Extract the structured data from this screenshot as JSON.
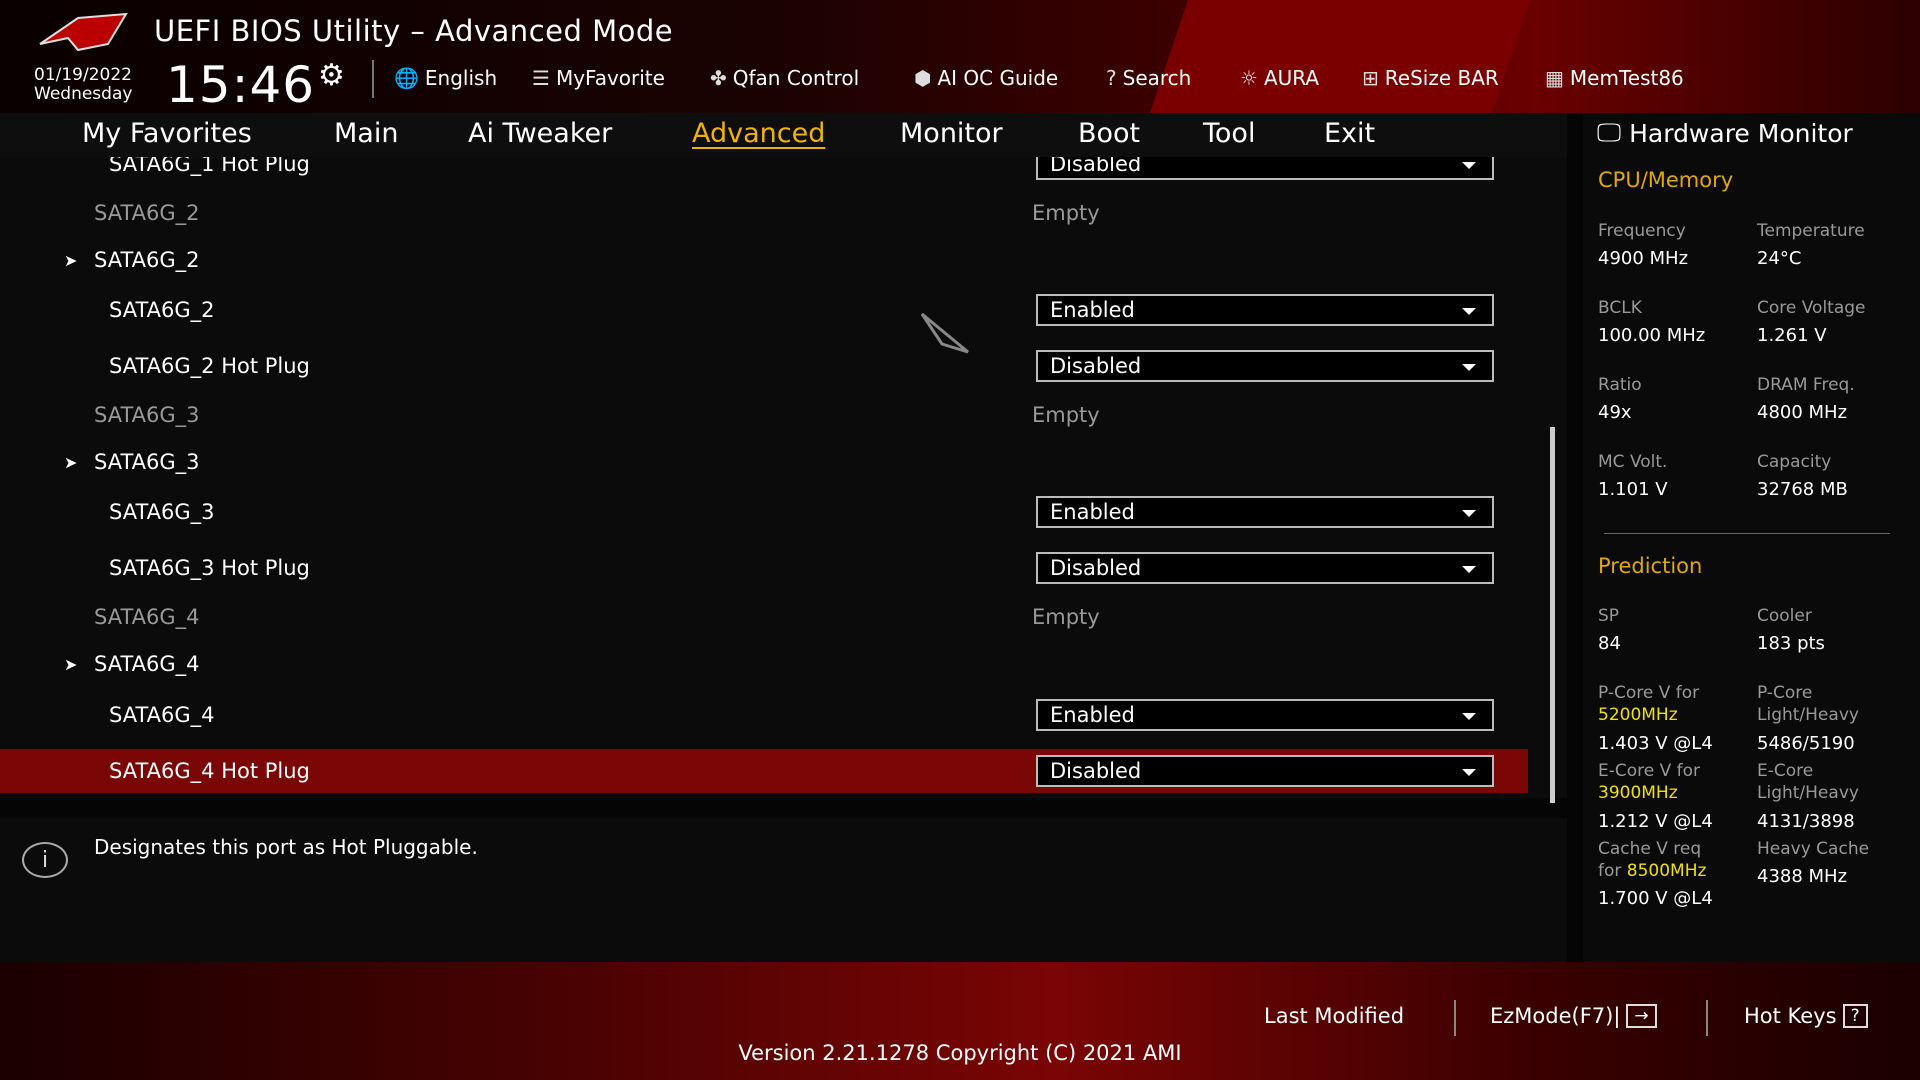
{
  "header": {
    "title": "UEFI BIOS Utility – Advanced Mode",
    "date": "01/19/2022",
    "day": "Wednesday",
    "time": "15:46"
  },
  "toolbar": [
    {
      "icon": "globe-icon",
      "label": "English"
    },
    {
      "icon": "list-icon",
      "label": "MyFavorite"
    },
    {
      "icon": "fan-icon",
      "label": "Qfan Control"
    },
    {
      "icon": "chip-icon",
      "label": "AI OC Guide"
    },
    {
      "icon": "help-box-icon",
      "label": "Search"
    },
    {
      "icon": "aura-icon",
      "label": "AURA"
    },
    {
      "icon": "resize-bar-icon",
      "label": "ReSize BAR"
    },
    {
      "icon": "memory-icon",
      "label": "MemTest86"
    }
  ],
  "nav": [
    "My Favorites",
    "Main",
    "Ai Tweaker",
    "Advanced",
    "Monitor",
    "Boot",
    "Tool",
    "Exit"
  ],
  "nav_active": "Advanced",
  "rows": [
    {
      "type": "dd",
      "label": "SATA6G_1 Hot Plug",
      "value": "Disabled"
    },
    {
      "type": "info",
      "label": "SATA6G_2",
      "value": "Empty"
    },
    {
      "type": "group",
      "label": "SATA6G_2"
    },
    {
      "type": "dd",
      "label": "SATA6G_2",
      "value": "Enabled"
    },
    {
      "type": "dd",
      "label": "SATA6G_2 Hot Plug",
      "value": "Disabled"
    },
    {
      "type": "info",
      "label": "SATA6G_3",
      "value": "Empty"
    },
    {
      "type": "group",
      "label": "SATA6G_3"
    },
    {
      "type": "dd",
      "label": "SATA6G_3",
      "value": "Enabled"
    },
    {
      "type": "dd",
      "label": "SATA6G_3 Hot Plug",
      "value": "Disabled"
    },
    {
      "type": "info",
      "label": "SATA6G_4",
      "value": "Empty"
    },
    {
      "type": "group",
      "label": "SATA6G_4"
    },
    {
      "type": "dd",
      "label": "SATA6G_4",
      "value": "Enabled"
    },
    {
      "type": "dd",
      "label": "SATA6G_4 Hot Plug",
      "value": "Disabled",
      "selected": true
    }
  ],
  "help": "Designates this port as Hot Pluggable.",
  "hw": {
    "title": "Hardware Monitor",
    "cpu_title": "CPU/Memory",
    "cpu": [
      [
        "Frequency",
        "4900 MHz"
      ],
      [
        "Temperature",
        "24°C"
      ],
      [
        "BCLK",
        "100.00 MHz"
      ],
      [
        "Core Voltage",
        "1.261 V"
      ],
      [
        "Ratio",
        "49x"
      ],
      [
        "DRAM Freq.",
        "4800 MHz"
      ],
      [
        "MC Volt.",
        "1.101 V"
      ],
      [
        "Capacity",
        "32768 MB"
      ]
    ],
    "pred_title": "Prediction",
    "sp_label": "SP",
    "sp": "84",
    "cooler_label": "Cooler",
    "cooler": "183 pts",
    "pcore_label": "P-Core V for",
    "pcore_freq": "5200MHz",
    "pcore_v": "1.403 V @L4",
    "pcore_lh_label1": "P-Core",
    "pcore_lh_label2": "Light/Heavy",
    "pcore_lh": "5486/5190",
    "ecore_label": "E-Core V for",
    "ecore_freq": "3900MHz",
    "ecore_v": "1.212 V @L4",
    "ecore_lh_label1": "E-Core",
    "ecore_lh_label2": "Light/Heavy",
    "ecore_lh": "4131/3898",
    "cache_label1": "Cache V req",
    "cache_label2": "for",
    "cache_freq": "8500MHz",
    "cache_v": "1.700 V @L4",
    "hcache_label": "Heavy Cache",
    "hcache": "4388 MHz"
  },
  "footer": {
    "last_modified": "Last Modified",
    "ezmode": "EzMode(F7)|",
    "hotkeys": "Hot Keys",
    "version": "Version 2.21.1278 Copyright (C) 2021 AMI"
  },
  "colors": {
    "accent": "#f0b400",
    "highlight": "#7a0606",
    "yellow": "#f0e000"
  }
}
